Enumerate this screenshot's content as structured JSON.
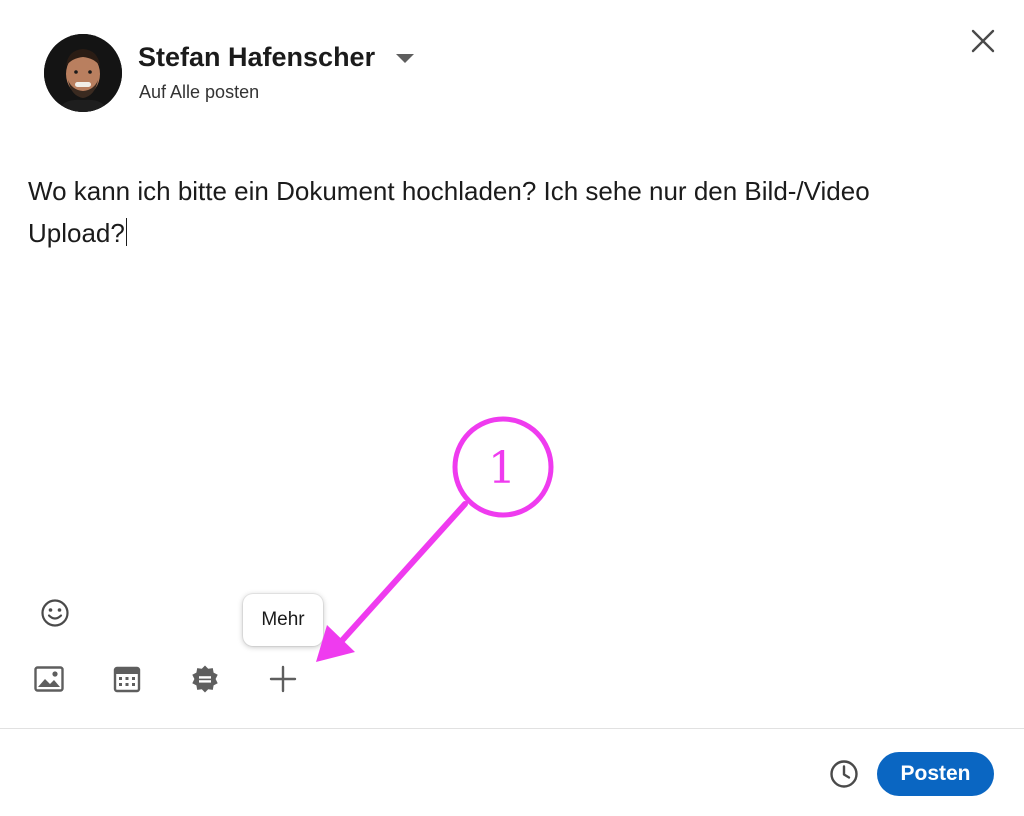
{
  "header": {
    "author_name": "Stefan Hafenscher",
    "audience": "Auf Alle posten",
    "avatar_icon": "user-avatar",
    "close_icon": "close-icon"
  },
  "composer": {
    "text": "Wo kann ich bitte ein Dokument hochladen? Ich sehe nur den Bild-/Video Upload?"
  },
  "toolbar": {
    "emoji_icon": "smiley-icon",
    "items": [
      {
        "name": "media",
        "icon": "image-icon"
      },
      {
        "name": "event",
        "icon": "calendar-icon"
      },
      {
        "name": "celebrate",
        "icon": "badge-icon"
      },
      {
        "name": "more",
        "icon": "plus-icon"
      }
    ],
    "tooltip": "Mehr"
  },
  "footer": {
    "schedule_icon": "clock-icon",
    "post_label": "Posten"
  },
  "annotation": {
    "number": "1",
    "color": "#ef3bef"
  },
  "colors": {
    "primary": "#0a66c2",
    "icon": "#5e5e5e",
    "text": "#1b1b1b"
  }
}
